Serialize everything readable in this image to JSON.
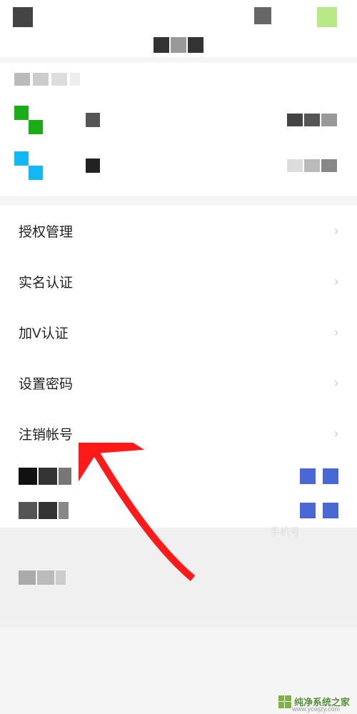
{
  "menu": {
    "authorize": "授权管理",
    "realname": "实名认证",
    "vcert": "加V认证",
    "setpwd": "设置密码",
    "deactivate": "注销帐号"
  },
  "lower_hint": "手机号",
  "watermark": {
    "name": "纯净系统之家",
    "url": "www.ycwjzy.com"
  },
  "colors": {
    "wechat_green": "#1aad19",
    "qq_blue": "#12b7f5",
    "accent_blue": "#4968d4",
    "lime": "#b8e986"
  }
}
